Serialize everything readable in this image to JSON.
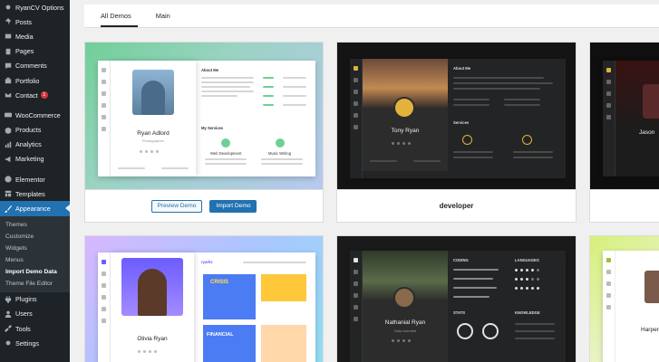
{
  "sidebar": {
    "items": [
      {
        "label": "RyanCV Options",
        "icon": "gear-icon"
      },
      {
        "label": "Posts",
        "icon": "pin-icon"
      },
      {
        "label": "Media",
        "icon": "media-icon"
      },
      {
        "label": "Pages",
        "icon": "page-icon"
      },
      {
        "label": "Comments",
        "icon": "comment-icon"
      },
      {
        "label": "Portfolio",
        "icon": "portfolio-icon"
      },
      {
        "label": "Contact",
        "icon": "mail-icon",
        "badge": "1"
      },
      {
        "label": "WooCommerce",
        "icon": "woo-icon"
      },
      {
        "label": "Products",
        "icon": "products-icon"
      },
      {
        "label": "Analytics",
        "icon": "analytics-icon"
      },
      {
        "label": "Marketing",
        "icon": "megaphone-icon"
      },
      {
        "label": "Elementor",
        "icon": "elementor-icon"
      },
      {
        "label": "Templates",
        "icon": "templates-icon"
      },
      {
        "label": "Appearance",
        "icon": "brush-icon"
      }
    ],
    "appearance_submenu": [
      "Themes",
      "Customize",
      "Widgets",
      "Menus",
      "Import Demo Data",
      "Theme File Editor"
    ],
    "after_items": [
      {
        "label": "Plugins",
        "icon": "plugin-icon"
      },
      {
        "label": "Users",
        "icon": "users-icon"
      },
      {
        "label": "Tools",
        "icon": "tools-icon"
      },
      {
        "label": "Settings",
        "icon": "settings-icon"
      }
    ]
  },
  "tabs": [
    {
      "label": "All Demos"
    },
    {
      "label": "Main"
    }
  ],
  "demos": {
    "card1": {
      "person": "Ryan Adlord",
      "subtitle": "Photographer",
      "section_about": "About Me",
      "section_services": "My Services",
      "service1": "Web Development",
      "service2": "Music Writing",
      "preview_label": "Preview Demo",
      "import_label": "Import Demo"
    },
    "card2": {
      "person": "Tony Ryan",
      "section_about": "About Me",
      "section_services": "Services",
      "name": "developer"
    },
    "card3": {
      "person": "Jason"
    },
    "card4": {
      "person": "Olivia Ryan",
      "logo": "ryarks",
      "tile1": "CRISIS",
      "tile2": "FINANCIAL"
    },
    "card5": {
      "person": "Nathanial Ryan",
      "subtitle": "Data scientist",
      "section_lang": "LANGUAGES",
      "section_know": "KNOWLEDGE",
      "section_skill": "CODING",
      "section_stat": "STATS"
    },
    "card6": {
      "person": "Harper"
    }
  },
  "colors": {
    "accent": "#2271b1",
    "sidebar": "#1d2327",
    "badge": "#d63638"
  }
}
